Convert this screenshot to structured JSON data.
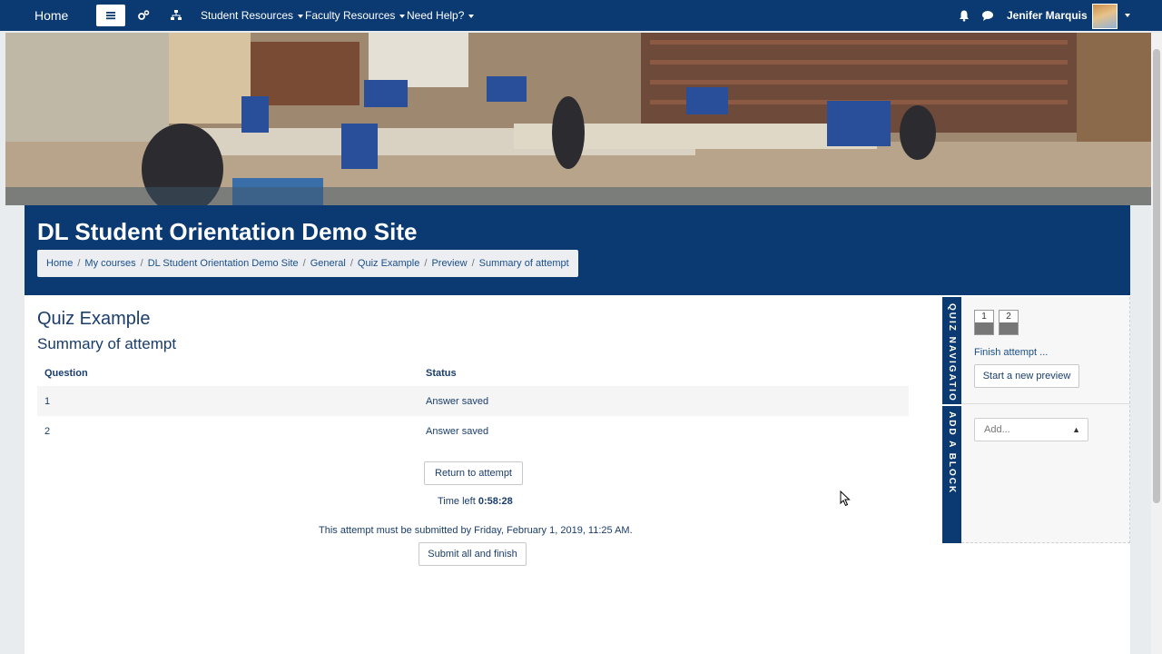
{
  "navbar": {
    "home": "Home",
    "menus": [
      {
        "label": "Student Resources"
      },
      {
        "label": "Faculty Resources"
      },
      {
        "label": "Need Help?"
      }
    ],
    "user_name": "Jenifer Marquis",
    "icons": [
      "hamburger-icon",
      "cogs-icon",
      "sitemap-icon",
      "bell-icon",
      "chat-icon"
    ]
  },
  "header": {
    "site_title": "DL Student Orientation Demo Site",
    "breadcrumb": [
      "Home",
      "My courses",
      "DL Student Orientation Demo Site",
      "General",
      "Quiz Example",
      "Preview",
      "Summary of attempt"
    ]
  },
  "main": {
    "quiz_title": "Quiz Example",
    "summary_title": "Summary of attempt",
    "table": {
      "headers": [
        "Question",
        "Status"
      ],
      "rows": [
        {
          "question": "1",
          "status": "Answer saved"
        },
        {
          "question": "2",
          "status": "Answer saved"
        }
      ]
    },
    "return_button": "Return to attempt",
    "time_left_label": "Time left",
    "time_left_value": "0:58:28",
    "submit_note": "This attempt must be submitted by Friday, February 1, 2019, 11:25 AM.",
    "submit_button": "Submit all and finish"
  },
  "drawer": {
    "tab_quiz_nav": "QUIZ NAVIGATIO",
    "tab_add_block": "ADD A BLOCK"
  },
  "sidebar": {
    "question_buttons": [
      "1",
      "2"
    ],
    "finish_attempt": "Finish attempt ...",
    "start_new_preview": "Start a new preview",
    "add_select": "Add..."
  },
  "colors": {
    "brand_navy": "#0b3a72",
    "link_blue": "#1a4f8a"
  }
}
